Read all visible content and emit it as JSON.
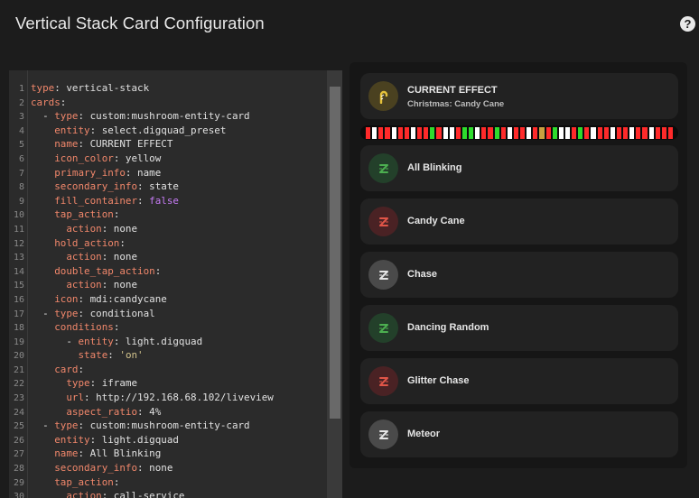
{
  "dialog": {
    "title": "Vertical Stack Card Configuration",
    "help": "?"
  },
  "editor": {
    "lines": [
      [
        [
          "k",
          "type"
        ],
        [
          "v",
          ": vertical-stack"
        ]
      ],
      [
        [
          "k",
          "cards"
        ],
        [
          "v",
          ":"
        ]
      ],
      [
        [
          "v",
          "  - "
        ],
        [
          "k",
          "type"
        ],
        [
          "v",
          ": custom:mushroom-entity-card"
        ]
      ],
      [
        [
          "v",
          "    "
        ],
        [
          "k",
          "entity"
        ],
        [
          "v",
          ": select.digquad_preset"
        ]
      ],
      [
        [
          "v",
          "    "
        ],
        [
          "k",
          "name"
        ],
        [
          "v",
          ": CURRENT EFFECT"
        ]
      ],
      [
        [
          "v",
          "    "
        ],
        [
          "k",
          "icon_color"
        ],
        [
          "v",
          ": yellow"
        ]
      ],
      [
        [
          "v",
          "    "
        ],
        [
          "k",
          "primary_info"
        ],
        [
          "v",
          ": name"
        ]
      ],
      [
        [
          "v",
          "    "
        ],
        [
          "k",
          "secondary_info"
        ],
        [
          "v",
          ": state"
        ]
      ],
      [
        [
          "v",
          "    "
        ],
        [
          "k",
          "fill_container"
        ],
        [
          "v",
          ": "
        ],
        [
          "b",
          "false"
        ]
      ],
      [
        [
          "v",
          "    "
        ],
        [
          "k",
          "tap_action"
        ],
        [
          "v",
          ":"
        ]
      ],
      [
        [
          "v",
          "      "
        ],
        [
          "k",
          "action"
        ],
        [
          "v",
          ": none"
        ]
      ],
      [
        [
          "v",
          "    "
        ],
        [
          "k",
          "hold_action"
        ],
        [
          "v",
          ":"
        ]
      ],
      [
        [
          "v",
          "      "
        ],
        [
          "k",
          "action"
        ],
        [
          "v",
          ": none"
        ]
      ],
      [
        [
          "v",
          "    "
        ],
        [
          "k",
          "double_tap_action"
        ],
        [
          "v",
          ":"
        ]
      ],
      [
        [
          "v",
          "      "
        ],
        [
          "k",
          "action"
        ],
        [
          "v",
          ": none"
        ]
      ],
      [
        [
          "v",
          "    "
        ],
        [
          "k",
          "icon"
        ],
        [
          "v",
          ": mdi:candycane"
        ]
      ],
      [
        [
          "v",
          "  - "
        ],
        [
          "k",
          "type"
        ],
        [
          "v",
          ": conditional"
        ]
      ],
      [
        [
          "v",
          "    "
        ],
        [
          "k",
          "conditions"
        ],
        [
          "v",
          ":"
        ]
      ],
      [
        [
          "v",
          "      - "
        ],
        [
          "k",
          "entity"
        ],
        [
          "v",
          ": light.digquad"
        ]
      ],
      [
        [
          "v",
          "        "
        ],
        [
          "k",
          "state"
        ],
        [
          "v",
          ": "
        ],
        [
          "s",
          "'on'"
        ]
      ],
      [
        [
          "v",
          "    "
        ],
        [
          "k",
          "card"
        ],
        [
          "v",
          ":"
        ]
      ],
      [
        [
          "v",
          "      "
        ],
        [
          "k",
          "type"
        ],
        [
          "v",
          ": iframe"
        ]
      ],
      [
        [
          "v",
          "      "
        ],
        [
          "k",
          "url"
        ],
        [
          "v",
          ": http://192.168.68.102/liveview"
        ]
      ],
      [
        [
          "v",
          "      "
        ],
        [
          "k",
          "aspect_ratio"
        ],
        [
          "v",
          ": 4%"
        ]
      ],
      [
        [
          "v",
          "  - "
        ],
        [
          "k",
          "type"
        ],
        [
          "v",
          ": custom:mushroom-entity-card"
        ]
      ],
      [
        [
          "v",
          "    "
        ],
        [
          "k",
          "entity"
        ],
        [
          "v",
          ": light.digquad"
        ]
      ],
      [
        [
          "v",
          "    "
        ],
        [
          "k",
          "name"
        ],
        [
          "v",
          ": All Blinking"
        ]
      ],
      [
        [
          "v",
          "    "
        ],
        [
          "k",
          "secondary_info"
        ],
        [
          "v",
          ": none"
        ]
      ],
      [
        [
          "v",
          "    "
        ],
        [
          "k",
          "tap_action"
        ],
        [
          "v",
          ":"
        ]
      ],
      [
        [
          "v",
          "      "
        ],
        [
          "k",
          "action"
        ],
        [
          "v",
          ": call-service"
        ]
      ]
    ]
  },
  "preview": {
    "current": {
      "name": "CURRENT EFFECT",
      "state": "Christmas: Candy Cane",
      "icon": "candycane-icon",
      "icon_bg": "#4a4120",
      "icon_color": "#e6c23a"
    },
    "leds": [
      "#ff2a2a",
      "#ffffff",
      "#ff2a2a",
      "#ff2a2a",
      "#ffffff",
      "#ff2a2a",
      "#ff2a2a",
      "#ffffff",
      "#ff2a2a",
      "#ff2a2a",
      "#2ddc2d",
      "#ff2a2a",
      "#ffffff",
      "#ffffff",
      "#ff2a2a",
      "#2ddc2d",
      "#2ddc2d",
      "#ffffff",
      "#ff2a2a",
      "#ff2a2a",
      "#2ddc2d",
      "#ff2a2a",
      "#ffffff",
      "#ff2a2a",
      "#ff2a2a",
      "#ffffff",
      "#ff2a2a",
      "#c8a040",
      "#ff2a2a",
      "#2ddc2d",
      "#ffffff",
      "#ffffff",
      "#ff2a2a",
      "#2ddc2d",
      "#ff2a2a",
      "#ffffff",
      "#ff2a2a",
      "#ff2a2a",
      "#ffffff",
      "#ff2a2a",
      "#ff2a2a",
      "#ffffff",
      "#ff2a2a",
      "#ff2a2a",
      "#ffffff",
      "#ff2a2a",
      "#ff2a2a",
      "#ff2a2a"
    ],
    "effects": [
      {
        "name": "All Blinking",
        "icon": "effect-icon",
        "icon_bg": "#23402a",
        "icon_color": "#4caf50"
      },
      {
        "name": "Candy Cane",
        "icon": "effect-icon",
        "icon_bg": "#4a2224",
        "icon_color": "#e05548"
      },
      {
        "name": "Chase",
        "icon": "effect-icon",
        "icon_bg": "#4a4a4a",
        "icon_color": "#e6e6e6"
      },
      {
        "name": "Dancing Random",
        "icon": "effect-icon",
        "icon_bg": "#23402a",
        "icon_color": "#4caf50"
      },
      {
        "name": "Glitter Chase",
        "icon": "effect-icon",
        "icon_bg": "#4a2224",
        "icon_color": "#e05548"
      },
      {
        "name": "Meteor",
        "icon": "effect-icon",
        "icon_bg": "#4a4a4a",
        "icon_color": "#e6e6e6"
      }
    ]
  }
}
